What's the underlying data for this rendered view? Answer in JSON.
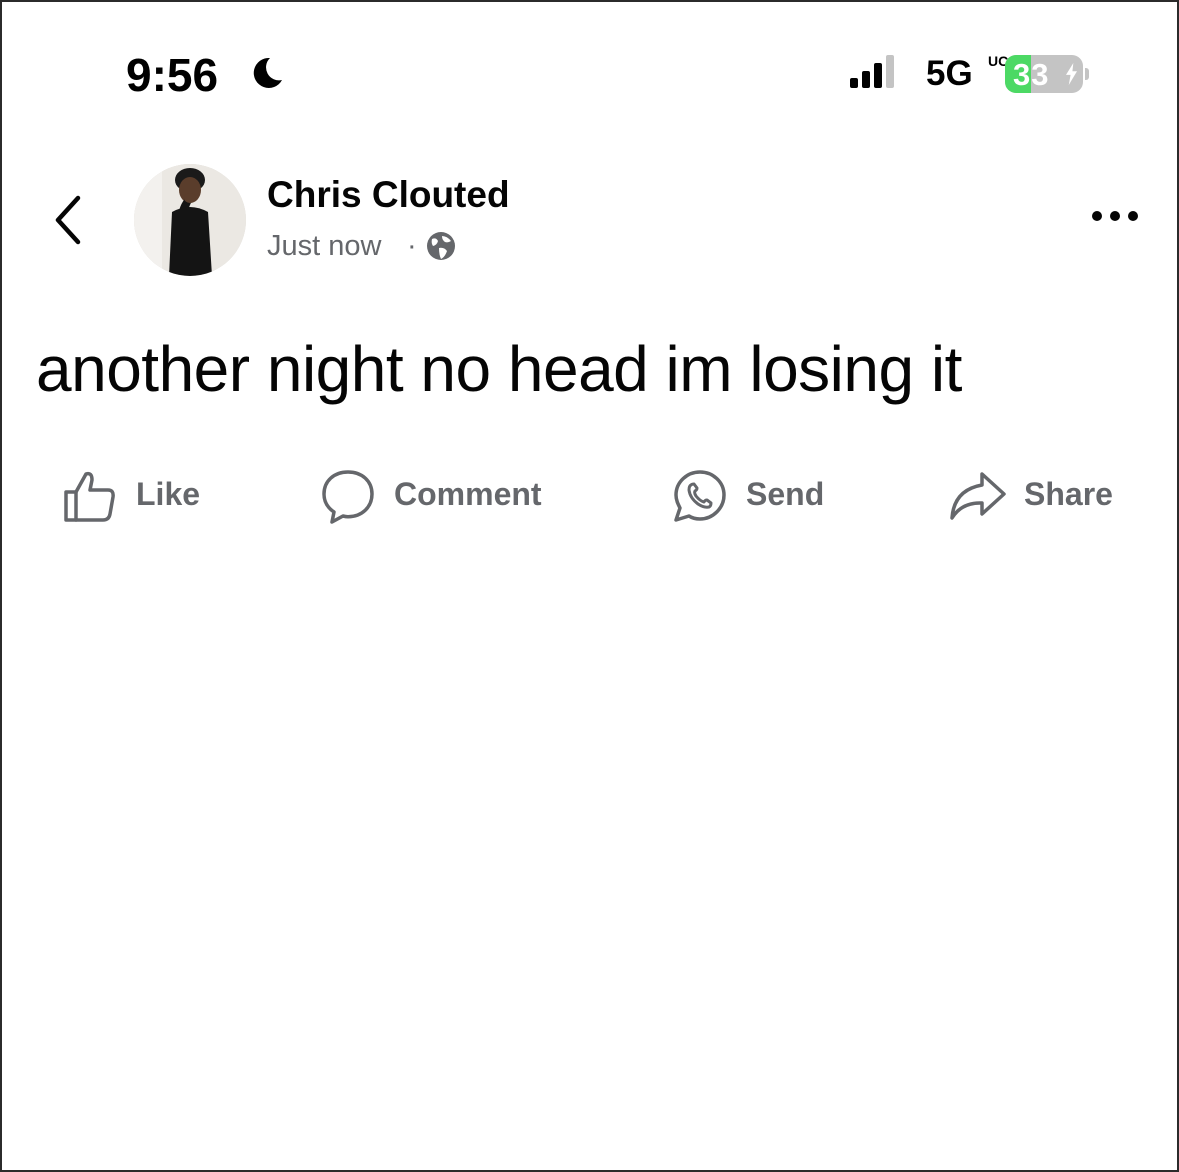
{
  "status_bar": {
    "time": "9:56",
    "time_icon": "moon-icon",
    "signal_icon": "cellular-signal-icon",
    "network": "5G",
    "network_suffix": "UC",
    "battery_level": "33",
    "battery_percent": 33,
    "battery_charging_icon": "bolt-icon",
    "battery_color": "#4cd964"
  },
  "header": {
    "back_icon": "chevron-left-icon",
    "author": "Chris Clouted",
    "timestamp": "Just now",
    "separator": "·",
    "audience_icon": "globe-icon",
    "more_icon": "more-horizontal-icon"
  },
  "post": {
    "text": "another night no head im losing it"
  },
  "actions": [
    {
      "label": "Like",
      "icon": "thumbs-up-icon"
    },
    {
      "label": "Comment",
      "icon": "comment-icon"
    },
    {
      "label": "Send",
      "icon": "whatsapp-icon"
    },
    {
      "label": "Share",
      "icon": "share-arrow-icon"
    }
  ],
  "colors": {
    "text_primary": "#050505",
    "text_secondary": "#65676b",
    "battery_green": "#4cd964"
  }
}
